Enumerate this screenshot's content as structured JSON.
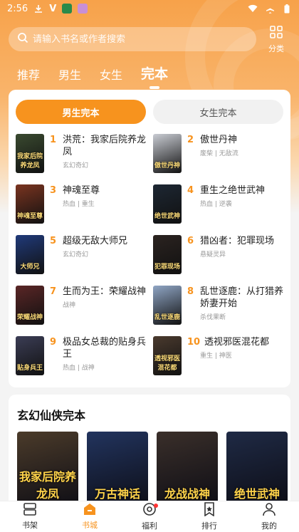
{
  "status": {
    "time": "2:56",
    "letter": "V"
  },
  "search": {
    "placeholder": "请输入书名或作者搜索"
  },
  "category_label": "分类",
  "tabs": [
    {
      "label": "推荐"
    },
    {
      "label": "男生"
    },
    {
      "label": "女生"
    },
    {
      "label": "完本"
    }
  ],
  "segments": {
    "male": "男生完本",
    "female": "女生完本"
  },
  "rankings": [
    {
      "rank": "1",
      "title": "洪荒：我家后院养龙凤",
      "meta": "玄幻奇幻",
      "cover_text": "我家后院养龙凤",
      "cover_color": "#3a4a30"
    },
    {
      "rank": "2",
      "title": "傲世丹神",
      "meta": "废柴 | 无敌流",
      "cover_text": "傲世丹神",
      "cover_color": "#c9ccd3"
    },
    {
      "rank": "3",
      "title": "神魂至尊",
      "meta": "热血 | 重生",
      "cover_text": "神魂至尊",
      "cover_color": "#7a3420"
    },
    {
      "rank": "4",
      "title": "重生之绝世武神",
      "meta": "热血 | 逆袭",
      "cover_text": "绝世武神",
      "cover_color": "#1d2733"
    },
    {
      "rank": "5",
      "title": "超级无敌大师兄",
      "meta": "玄幻奇幻",
      "cover_text": "大师兄",
      "cover_color": "#203a7a"
    },
    {
      "rank": "6",
      "title": "猎凶者：犯罪现场",
      "meta": "悬疑灵异",
      "cover_text": "犯罪现场",
      "cover_color": "#2b2320"
    },
    {
      "rank": "7",
      "title": "生而为王：荣耀战神",
      "meta": "战神",
      "cover_text": "荣耀战神",
      "cover_color": "#5a2626"
    },
    {
      "rank": "8",
      "title": "乱世逐鹿：从打猎养娇妻开始",
      "meta": "杀伐果断",
      "cover_text": "乱世逐鹿",
      "cover_color": "#8fa5c4"
    },
    {
      "rank": "9",
      "title": "极品女总裁的贴身兵王",
      "meta": "热血 | 战神",
      "cover_text": "贴身兵王",
      "cover_color": "#3b3d55"
    },
    {
      "rank": "10",
      "title": "透视邪医混花都",
      "meta": "重生 | 神医",
      "cover_text": "透视邪医混花都",
      "cover_color": "#4a3a2e"
    }
  ],
  "section": {
    "title": "玄幻仙侠完本",
    "covers": [
      {
        "text": "我家后院养龙凤",
        "color": "#4b3b2a"
      },
      {
        "text": "万古神话",
        "color": "#22345e"
      },
      {
        "text": "龙战战神",
        "color": "#3a2f2a"
      },
      {
        "text": "绝世武神",
        "color": "#1f2a45"
      }
    ]
  },
  "bottom_nav": [
    {
      "label": "书架"
    },
    {
      "label": "书城"
    },
    {
      "label": "福利"
    },
    {
      "label": "排行"
    },
    {
      "label": "我的"
    }
  ],
  "colors": {
    "accent": "#f7931e",
    "header": "#f7a24a"
  }
}
